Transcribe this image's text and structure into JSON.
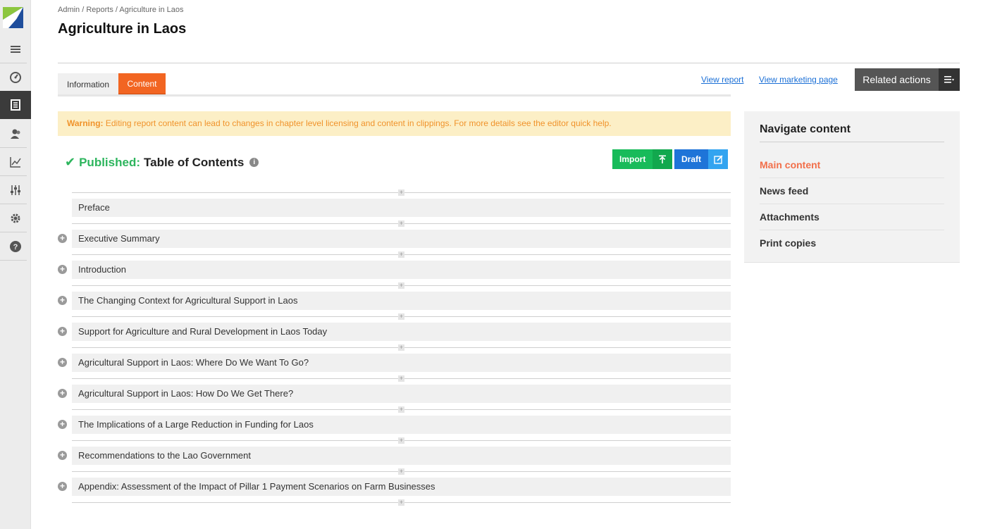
{
  "breadcrumb": "Admin / Reports / Agriculture in Laos",
  "page_title": "Agriculture in Laos",
  "tabs": [
    {
      "label": "Information",
      "active": false
    },
    {
      "label": "Content",
      "active": true
    }
  ],
  "header_links": {
    "view_report": "View report",
    "view_marketing": "View marketing page",
    "related_actions": "Related actions"
  },
  "warning": {
    "prefix": "Warning:",
    "text": " Editing report content can lead to changes in chapter level licensing and content in clippings. For more details see the editor quick help."
  },
  "status": {
    "label": "Published:",
    "title": "Table of Contents",
    "info": "i"
  },
  "buttons": {
    "import": "Import",
    "draft": "Draft"
  },
  "toc_items": [
    {
      "label": "Preface",
      "expandable": false
    },
    {
      "label": "Executive Summary",
      "expandable": true
    },
    {
      "label": "Introduction",
      "expandable": true
    },
    {
      "label": "The Changing Context for Agricultural Support in Laos",
      "expandable": true
    },
    {
      "label": "Support for Agriculture and Rural Development in Laos Today",
      "expandable": true
    },
    {
      "label": "Agricultural Support in Laos: Where Do We Want To Go?",
      "expandable": true
    },
    {
      "label": "Agricultural Support in Laos: How Do We Get There?",
      "expandable": true
    },
    {
      "label": "The Implications of a Large Reduction in Funding for Laos",
      "expandable": true
    },
    {
      "label": "Recommendations to the Lao Government",
      "expandable": true
    },
    {
      "label": "Appendix: Assessment of the Impact of Pillar 1 Payment Scenarios on Farm Businesses",
      "expandable": true
    }
  ],
  "nav_panel": {
    "title": "Navigate content",
    "items": [
      "Main content",
      "News feed",
      "Attachments",
      "Print copies"
    ],
    "active_index": 0
  },
  "sidebar_icons": [
    "menu-icon",
    "dashboard-icon",
    "document-icon",
    "users-icon",
    "chart-icon",
    "sliders-icon",
    "gear-icon",
    "help-icon"
  ],
  "colors": {
    "accent": "#f26522",
    "published": "#2db55d",
    "import": "#18bb5a",
    "draft": "#1e74d8",
    "warning_bg": "#fcefc6",
    "warning_text": "#f0932b"
  }
}
